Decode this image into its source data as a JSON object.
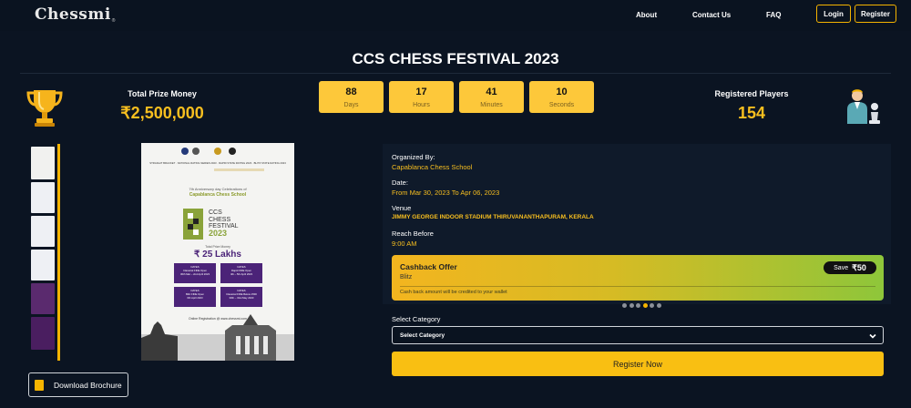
{
  "nav": {
    "logo": "Chessmi",
    "logo_tm": "®",
    "links": [
      "About",
      "Contact Us",
      "FAQ"
    ],
    "login": "Login",
    "register": "Register"
  },
  "event": {
    "title": "CCS CHESS FESTIVAL 2023"
  },
  "prize": {
    "label": "Total Prize Money",
    "value": "₹2,500,000"
  },
  "countdown": [
    {
      "value": "88",
      "unit": "Days"
    },
    {
      "value": "17",
      "unit": "Hours"
    },
    {
      "value": "41",
      "unit": "Minutes"
    },
    {
      "value": "10",
      "unit": "Seconds"
    }
  ],
  "players": {
    "label": "Registered Players",
    "value": "154"
  },
  "brochure": {
    "download_label": "Download Brochure",
    "poster": {
      "top_text": "STRAIGHT BRACKET  ·  NATIONAL RATING SERIES 2023  ·  RAPID STATE RATING 2023  ·  BLITZ STATE RATING 2023",
      "tagline": "7th Anniversary day Celebrations of",
      "school": "Capablanca Chess School",
      "fest_line1": "CCS",
      "fest_line2": "CHESS",
      "fest_line3": "FESTIVAL",
      "fest_year": "2023",
      "prize_caption": "Total Prize Money",
      "prize_value": "₹ 25 Lakhs",
      "cells": [
        {
          "head": "DATES",
          "l1": "Classical FIDE Open",
          "l2": "30th Mar – 2nd April 2023"
        },
        {
          "head": "DATES",
          "l1": "Rapid FIDE Open",
          "l2": "4th – 5th April 2023"
        },
        {
          "head": "DATES",
          "l1": "Blitz FIDE Open",
          "l2": "6th April 2023"
        },
        {
          "head": "DATES",
          "l1": "Classical FIDE Below 1500",
          "l2": "30th – 31st May 2023"
        }
      ],
      "footer": "Online Registration @ www.chessmi.com"
    }
  },
  "details": {
    "organized_label": "Organized By:",
    "organized_value": "Capablanca Chess School",
    "date_label": "Date:",
    "date_value": "From Mar 30, 2023 To Apr 06, 2023",
    "venue_label": "Venue",
    "venue_value": "JIMMY GEORGE INDOOR STADIUM THIRUVANANTHAPURAM, KERALA",
    "reach_label": "Reach Before",
    "reach_value": "9:00 AM"
  },
  "cashback": {
    "title": "Cashback Offer",
    "category": "Blitz",
    "note": "Cash back amount will be credited to your wallet",
    "save_label": "Save",
    "save_amount": "₹50",
    "slide_count": 6,
    "active_slide": 3
  },
  "category": {
    "label": "Select Category",
    "selected": "Select Category"
  },
  "cta": {
    "register_now": "Register Now"
  },
  "colors": {
    "accent": "#f5b400",
    "background": "#0b1422",
    "highlight_text": "#f8bf1f"
  }
}
